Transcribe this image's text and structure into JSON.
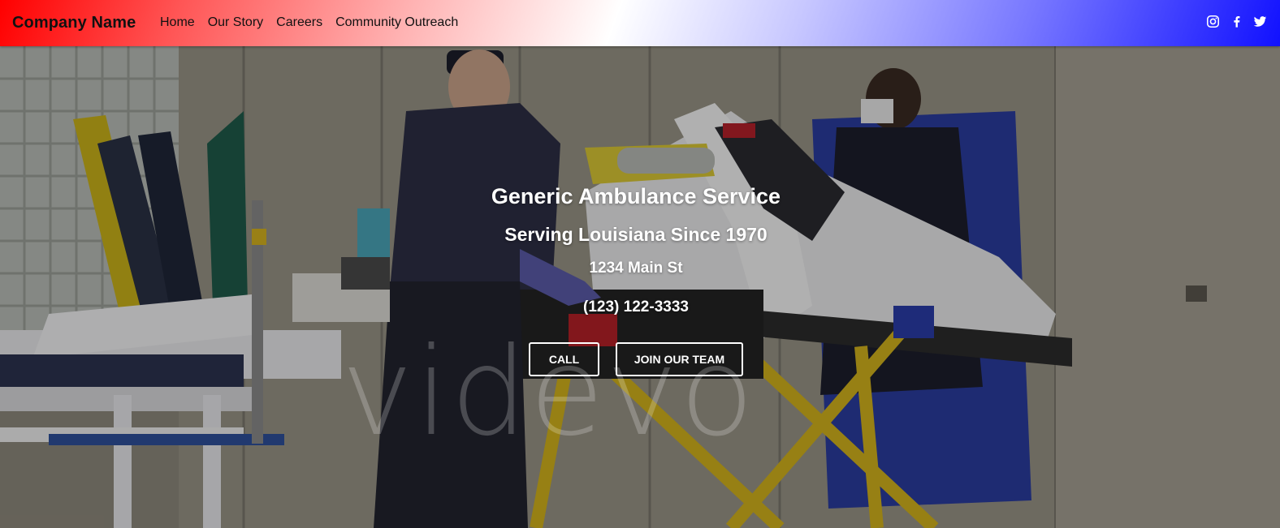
{
  "navbar": {
    "brand": "Company Name",
    "links": [
      "Home",
      "Our Story",
      "Careers",
      "Community Outreach"
    ],
    "social_icons": [
      "instagram-icon",
      "facebook-icon",
      "twitter-icon"
    ]
  },
  "hero": {
    "title": "Generic Ambulance Service",
    "subtitle": "Serving Louisiana Since 1970",
    "address": "1234 Main St",
    "phone": "(123) 122-3333",
    "buttons": {
      "call": "CALL",
      "join": "JOIN OUR TEAM"
    },
    "watermark": "videvo"
  },
  "colors": {
    "nav_gradient_start": "#ff0000",
    "nav_gradient_mid": "#ffffff",
    "nav_gradient_end": "#1111ff",
    "hero_text": "#ffffff"
  }
}
